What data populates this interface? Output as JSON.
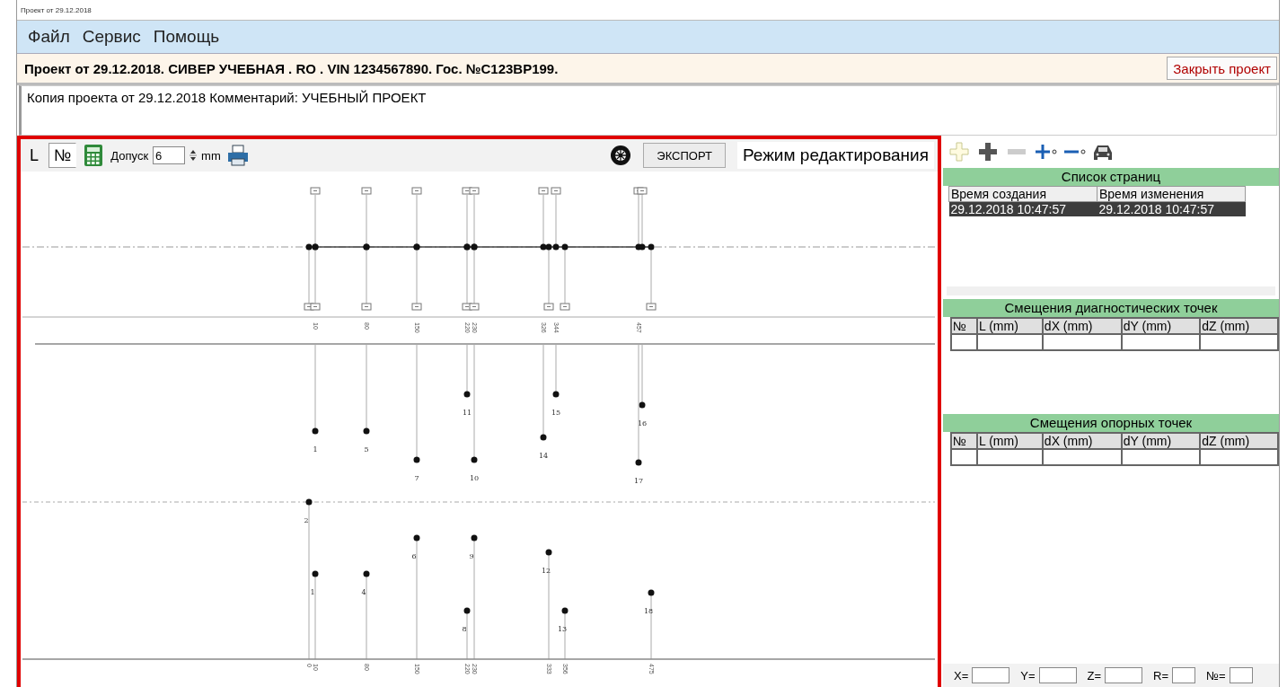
{
  "window": {
    "title": "Проект от 29.12.2018"
  },
  "menu": [
    {
      "label": "Файл"
    },
    {
      "label": "Сервис"
    },
    {
      "label": "Помощь"
    }
  ],
  "project": {
    "title": "Проект от 29.12.2018.  СИВЕР УЧЕБНАЯ . RO  . VIN 1234567890. Гос. №C123BP199.",
    "close_button": "Закрыть проект"
  },
  "comment": {
    "value": "Копия проекта от 29.12.2018  Комментарий:  УЧЕБНЫЙ ПРОЕКТ"
  },
  "toolbar": {
    "toggles": [
      {
        "label": "L",
        "selected": false
      },
      {
        "label": "№",
        "selected": true
      }
    ],
    "tolerance_label": "Допуск",
    "tolerance_value": "6",
    "unit": "mm",
    "export_button": "ЭКСПОРТ",
    "mode_label": "Режим редактирования"
  },
  "diagram": {
    "top_scale": [
      "10",
      "80",
      "150",
      "220",
      "230",
      "326",
      "344",
      "457"
    ],
    "upper_points": [
      {
        "label": "1"
      },
      {
        "label": "5"
      },
      {
        "label": "7"
      },
      {
        "label": "11"
      },
      {
        "label": "10"
      },
      {
        "label": "14"
      },
      {
        "label": "15"
      },
      {
        "label": "16"
      },
      {
        "label": "17"
      }
    ],
    "lower_points": [
      {
        "label": "2"
      },
      {
        "label": "1"
      },
      {
        "label": "4"
      },
      {
        "label": "6"
      },
      {
        "label": "8"
      },
      {
        "label": "9"
      },
      {
        "label": "12"
      },
      {
        "label": "13"
      },
      {
        "label": "18"
      }
    ],
    "bottom_scale": [
      "0",
      "10",
      "80",
      "150",
      "220",
      "230",
      "333",
      "356",
      "475"
    ]
  },
  "pages": {
    "title": "Список страниц",
    "columns": [
      "Время создания",
      "Время изменения"
    ],
    "rows": [
      {
        "cells": [
          "29.12.2018 10:47:57",
          "29.12.2018 10:47:57"
        ],
        "selected": true
      }
    ]
  },
  "diag_offsets": {
    "title": "Смещения диагностических точек",
    "columns": [
      "№",
      "L (mm)",
      "dX (mm)",
      "dY (mm)",
      "dZ (mm)"
    ]
  },
  "ref_offsets": {
    "title": "Смещения опорных точек",
    "columns": [
      "№",
      "L (mm)",
      "dX (mm)",
      "dY (mm)",
      "dZ (mm)"
    ]
  },
  "coords": [
    {
      "label": "X="
    },
    {
      "label": "Y="
    },
    {
      "label": "Z="
    },
    {
      "label": "R="
    },
    {
      "label": "№="
    }
  ]
}
